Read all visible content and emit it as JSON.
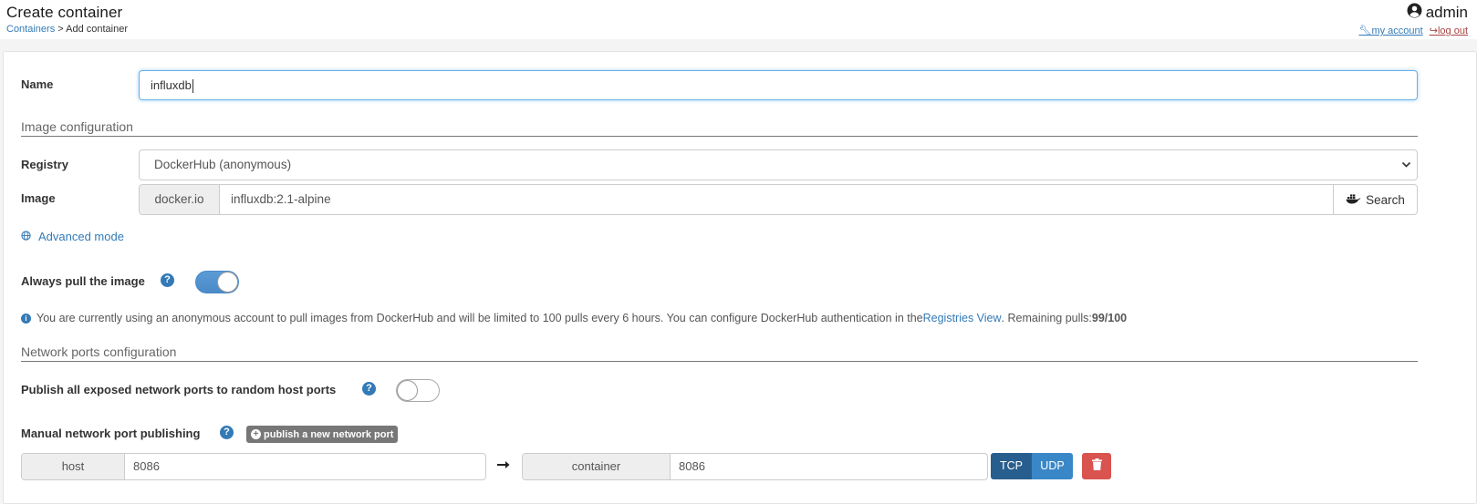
{
  "header": {
    "title": "Create container",
    "breadcrumb": {
      "link": "Containers",
      "separator": " > ",
      "current": "Add container"
    },
    "user": {
      "name": "admin",
      "my_account": "my account",
      "log_out": "log out"
    }
  },
  "form": {
    "name_label": "Name",
    "name_value": "influxdb",
    "image_section_title": "Image configuration",
    "registry_label": "Registry",
    "registry_value": "DockerHub (anonymous)",
    "image_label": "Image",
    "image_prefix": "docker.io",
    "image_value": "influxdb:2.1-alpine",
    "search_label": "Search",
    "advanced_mode": "Advanced mode",
    "always_pull_label": "Always pull the image",
    "always_pull_on": true,
    "info": {
      "text_before": "You are currently using an anonymous account to pull images from DockerHub and will be limited to 100 pulls every 6 hours. You can configure DockerHub authentication in the ",
      "link": "Registries View",
      "text_after": ". Remaining pulls: ",
      "remaining": "99/100"
    },
    "network_section_title": "Network ports configuration",
    "publish_all_label": "Publish all exposed network ports to random host ports",
    "publish_all_on": false,
    "manual_label": "Manual network port publishing",
    "publish_new_label": "publish a new network port",
    "port_mapping": {
      "host_label": "host",
      "host_value": "8086",
      "container_label": "container",
      "container_value": "8086",
      "protocols": [
        "TCP",
        "UDP"
      ],
      "selected_protocol": "TCP"
    }
  },
  "colors": {
    "primary": "#337ab7",
    "danger": "#d9534f",
    "tcp_active": "#285e8e"
  }
}
